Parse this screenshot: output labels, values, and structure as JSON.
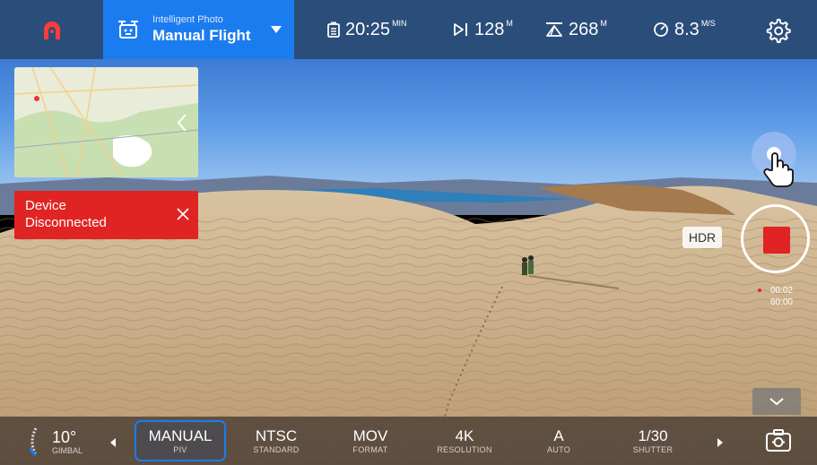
{
  "header": {
    "mode_sub": "Intelligent Photo",
    "mode_main": "Manual Flight",
    "stats": [
      {
        "icon": "battery-icon",
        "value": "20:25",
        "unit": "MIN"
      },
      {
        "icon": "distance-icon",
        "value": "128",
        "unit": "M"
      },
      {
        "icon": "altitude-icon",
        "value": "268",
        "unit": "M"
      },
      {
        "icon": "speed-icon",
        "value": "8.3",
        "unit": "M/S"
      }
    ]
  },
  "alert": {
    "message": "Device Disconnected"
  },
  "camera": {
    "hdr_label": "HDR",
    "rec_elapsed": "00:02",
    "rec_total": "60:00"
  },
  "bottom": {
    "gimbal_value": "10°",
    "gimbal_label": "GIMBAL",
    "params": [
      {
        "value": "MANUAL",
        "label": "PIV"
      },
      {
        "value": "NTSC",
        "label": "STANDARD"
      },
      {
        "value": "MOV",
        "label": "FORMAT"
      },
      {
        "value": "4K",
        "label": "RESOLUTION"
      },
      {
        "value": "A",
        "label": "AUTO"
      },
      {
        "value": "1/30",
        "label": "SHUTTER"
      }
    ]
  },
  "colors": {
    "topbar": "#2b4d7a",
    "accent": "#1b7cf0",
    "alert": "#e02424",
    "record": "#e02424"
  }
}
